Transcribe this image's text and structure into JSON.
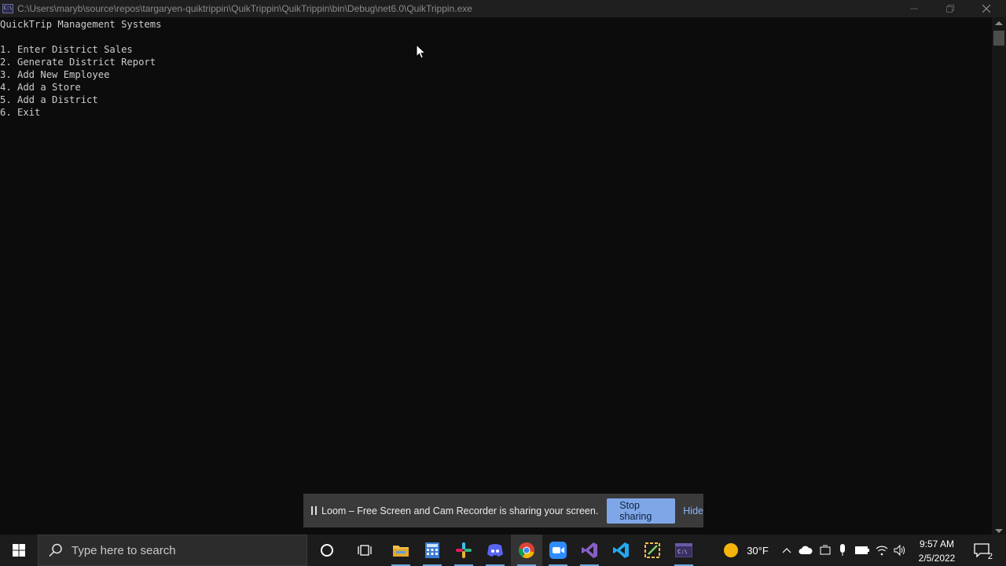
{
  "window": {
    "title": "C:\\Users\\maryb\\source\\repos\\targaryen-quiktrippin\\QuikTrippin\\QuikTrippin\\bin\\Debug\\net6.0\\QuikTrippin.exe",
    "app_icon_text": "C:\\"
  },
  "console": {
    "heading": "QuickTrip Management Systems",
    "menu": [
      "1. Enter District Sales",
      "2. Generate District Report",
      "3. Add New Employee",
      "4. Add a Store",
      "5. Add a District",
      "6. Exit"
    ]
  },
  "loom": {
    "message": "Loom – Free Screen and Cam Recorder is sharing your screen.",
    "stop_label": "Stop sharing",
    "hide_label": "Hide"
  },
  "taskbar": {
    "search_placeholder": "Type here to search",
    "apps": [
      "start-icon",
      "cortana-icon",
      "task-view-icon",
      "file-explorer-icon",
      "calculator-icon",
      "slack-icon",
      "discord-icon",
      "chrome-icon",
      "zoom-icon",
      "visual-studio-icon",
      "vscode-icon",
      "snip-icon",
      "terminal-icon"
    ],
    "weather": "30°F",
    "time": "9:57 AM",
    "date": "2/5/2022",
    "notification_count": "2"
  },
  "colors": {
    "console_bg": "#0c0c0c",
    "console_text": "#cccccc",
    "accent": "#7fa7e8",
    "taskbar_bg": "#1c1c1c"
  }
}
